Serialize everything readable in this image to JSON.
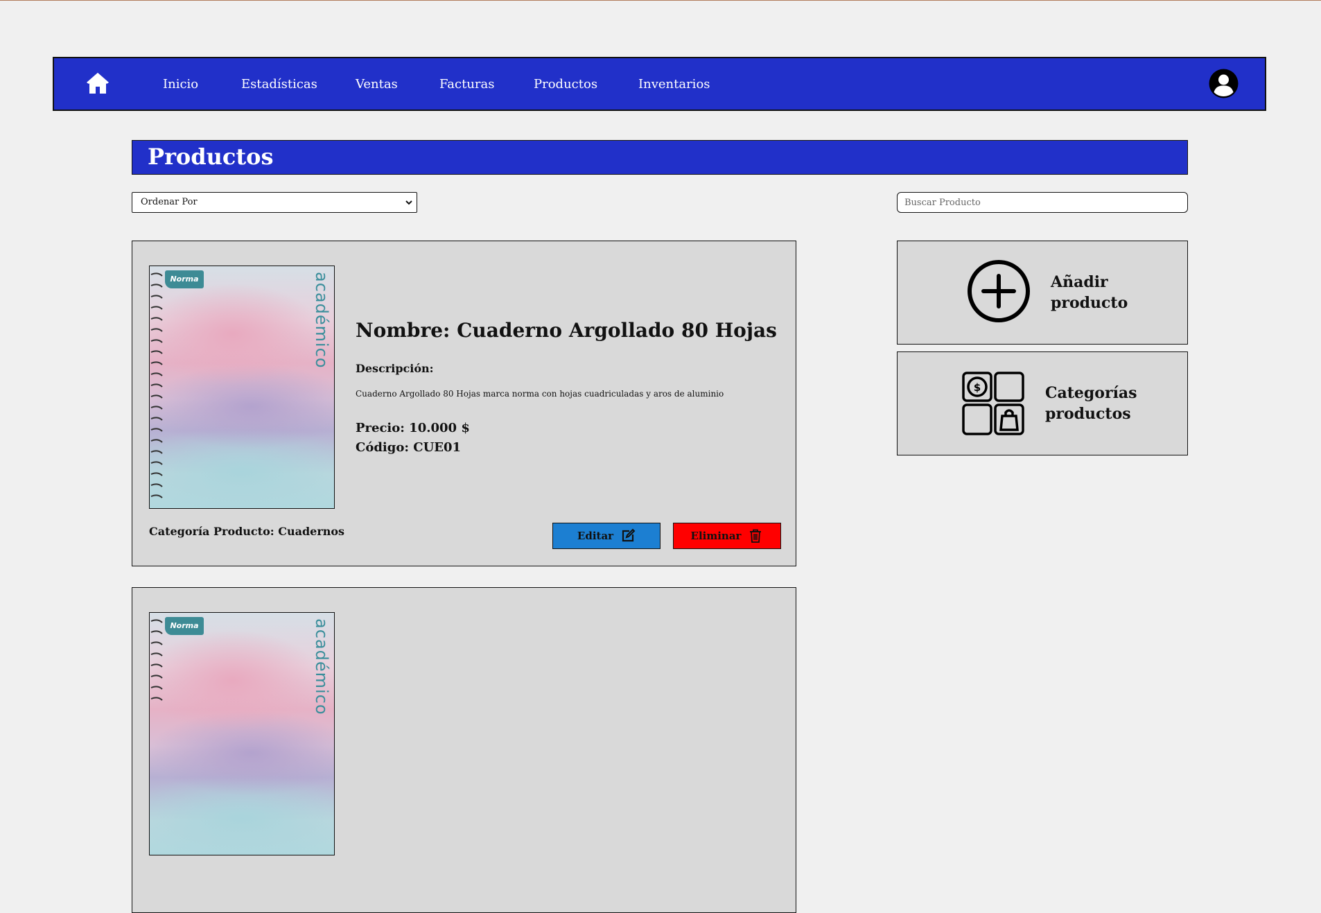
{
  "nav": {
    "home_icon": "home-icon",
    "items": [
      {
        "label": "Inicio"
      },
      {
        "label": "Estadísticas"
      },
      {
        "label": "Ventas"
      },
      {
        "label": "Facturas"
      },
      {
        "label": "Productos"
      },
      {
        "label": "Inventarios"
      }
    ],
    "user_icon": "user-avatar-icon"
  },
  "page": {
    "title": "Productos"
  },
  "controls": {
    "order_by_selected": "Ordenar Por",
    "search_placeholder": "Buscar Producto"
  },
  "products": [
    {
      "brand": "Norma",
      "cover_text": "académico",
      "name": "Nombre: Cuaderno Argollado 80 Hojas",
      "description_label": "Descripción:",
      "description": "Cuaderno Argollado 80 Hojas marca norma con hojas cuadriculadas y aros de aluminio",
      "price": "Precio: 10.000 $",
      "code": "Código: CUE01",
      "category": "Categoría Producto: Cuadernos",
      "edit_label": "Editar",
      "delete_label": "Eliminar"
    },
    {
      "brand": "Norma",
      "cover_text": "académico"
    }
  ],
  "side_actions": {
    "add_product": {
      "label_line1": "Añadir",
      "label_line2": "producto",
      "icon": "plus-circle-icon"
    },
    "categories": {
      "label_line1": "Categorías",
      "label_line2": "productos",
      "icon": "categories-grid-icon"
    }
  },
  "colors": {
    "primary": "#2130c9",
    "card_bg": "#d9d9d9",
    "edit_button": "#1c7fd2",
    "delete_button": "#ff0000",
    "page_bg": "#f0f0f0"
  }
}
